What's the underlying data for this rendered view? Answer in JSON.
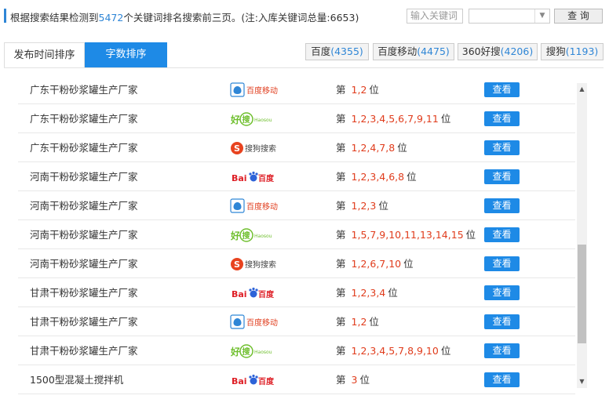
{
  "header": {
    "summary_prefix": "根据搜索结果检测到",
    "keyword_count": "5472",
    "summary_suffix": "个关键词排名搜索前三页。(注:入库关键词总量:6653)",
    "search_placeholder": "输入关键词",
    "query_label": "查 询"
  },
  "tabs": [
    {
      "label": "发布时间排序",
      "active": false
    },
    {
      "label": "字数排序",
      "active": true
    }
  ],
  "engines": [
    {
      "name": "百度",
      "count": "(4355)"
    },
    {
      "name": "百度移动",
      "count": "(4475)"
    },
    {
      "name": "360好搜",
      "count": "(4206)"
    },
    {
      "name": "搜狗",
      "count": "(1193)"
    }
  ],
  "rank_prefix": "第",
  "rank_suffix": "位",
  "view_label": "查看",
  "logo_text": {
    "baidu_mobile": "百度移动",
    "haosou": "好",
    "haosou_sub": "搜",
    "haosou_en": "Haosou",
    "sogou": "搜狗搜索",
    "baidu_left": "Bai",
    "baidu_right": "百度"
  },
  "rows": [
    {
      "keyword": "广东干粉砂浆罐生产厂家",
      "engine": "baidu_mobile",
      "positions": "1,2"
    },
    {
      "keyword": "广东干粉砂浆罐生产厂家",
      "engine": "haosou",
      "positions": "1,2,3,4,5,6,7,9,11"
    },
    {
      "keyword": "广东干粉砂浆罐生产厂家",
      "engine": "sogou",
      "positions": "1,2,4,7,8"
    },
    {
      "keyword": "河南干粉砂浆罐生产厂家",
      "engine": "baidu",
      "positions": "1,2,3,4,6,8"
    },
    {
      "keyword": "河南干粉砂浆罐生产厂家",
      "engine": "baidu_mobile",
      "positions": "1,2,3"
    },
    {
      "keyword": "河南干粉砂浆罐生产厂家",
      "engine": "haosou",
      "positions": "1,5,7,9,10,11,13,14,15"
    },
    {
      "keyword": "河南干粉砂浆罐生产厂家",
      "engine": "sogou",
      "positions": "1,2,6,7,10"
    },
    {
      "keyword": "甘肃干粉砂浆罐生产厂家",
      "engine": "baidu",
      "positions": "1,2,3,4"
    },
    {
      "keyword": "甘肃干粉砂浆罐生产厂家",
      "engine": "baidu_mobile",
      "positions": "1,2"
    },
    {
      "keyword": "甘肃干粉砂浆罐生产厂家",
      "engine": "haosou",
      "positions": "1,2,3,4,5,7,8,9,10"
    },
    {
      "keyword": "1500型混凝土搅拌机",
      "engine": "baidu",
      "positions": "3"
    }
  ],
  "colors": {
    "accent": "#1e8ae6",
    "rank": "#e03c1c",
    "count": "#2f86d6"
  }
}
